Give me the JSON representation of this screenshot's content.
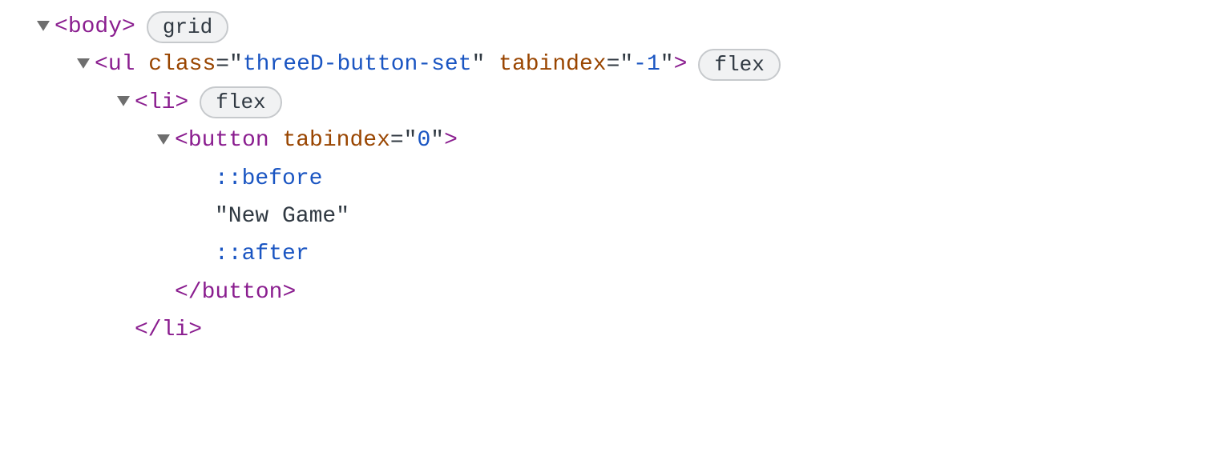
{
  "rows": [
    {
      "indent": 40,
      "twisty": true,
      "parts": [
        {
          "cls": "punct",
          "t": "<"
        },
        {
          "cls": "tag",
          "t": "body"
        },
        {
          "cls": "punct",
          "t": ">"
        }
      ],
      "badge": "grid",
      "name": "dom-node-body",
      "interactable": true
    },
    {
      "indent": 90,
      "twisty": true,
      "parts": [
        {
          "cls": "punct",
          "t": "<"
        },
        {
          "cls": "tag",
          "t": "ul"
        },
        {
          "cls": "text",
          "t": " "
        },
        {
          "cls": "attr",
          "t": "class"
        },
        {
          "cls": "eq",
          "t": "=\""
        },
        {
          "cls": "val",
          "t": "threeD-button-set"
        },
        {
          "cls": "eq",
          "t": "\""
        },
        {
          "cls": "text",
          "t": " "
        },
        {
          "cls": "attr",
          "t": "tabindex"
        },
        {
          "cls": "eq",
          "t": "=\""
        },
        {
          "cls": "val",
          "t": "-1"
        },
        {
          "cls": "eq",
          "t": "\""
        },
        {
          "cls": "punct",
          "t": ">"
        }
      ],
      "badge": "flex",
      "name": "dom-node-ul",
      "interactable": true
    },
    {
      "indent": 140,
      "twisty": true,
      "parts": [
        {
          "cls": "punct",
          "t": "<"
        },
        {
          "cls": "tag",
          "t": "li"
        },
        {
          "cls": "punct",
          "t": ">"
        }
      ],
      "badge": "flex",
      "name": "dom-node-li",
      "interactable": true
    },
    {
      "indent": 190,
      "twisty": true,
      "parts": [
        {
          "cls": "punct",
          "t": "<"
        },
        {
          "cls": "tag",
          "t": "button"
        },
        {
          "cls": "text",
          "t": " "
        },
        {
          "cls": "attr",
          "t": "tabindex"
        },
        {
          "cls": "eq",
          "t": "=\""
        },
        {
          "cls": "val",
          "t": "0"
        },
        {
          "cls": "eq",
          "t": "\""
        },
        {
          "cls": "punct",
          "t": ">"
        }
      ],
      "badge": null,
      "name": "dom-node-button-open",
      "interactable": true
    },
    {
      "indent": 268,
      "twisty": false,
      "parts": [
        {
          "cls": "pseudo",
          "t": "::before"
        }
      ],
      "badge": null,
      "name": "pseudo-before",
      "interactable": true
    },
    {
      "indent": 268,
      "twisty": false,
      "parts": [
        {
          "cls": "text",
          "t": "\"New Game\""
        }
      ],
      "badge": null,
      "name": "text-node-new-game",
      "interactable": true
    },
    {
      "indent": 268,
      "twisty": false,
      "parts": [
        {
          "cls": "pseudo",
          "t": "::after"
        }
      ],
      "badge": null,
      "name": "pseudo-after",
      "interactable": true
    },
    {
      "indent": 218,
      "twisty": false,
      "parts": [
        {
          "cls": "punct",
          "t": "</"
        },
        {
          "cls": "tag",
          "t": "button"
        },
        {
          "cls": "punct",
          "t": ">"
        }
      ],
      "badge": null,
      "name": "dom-node-button-close",
      "interactable": true
    },
    {
      "indent": 168,
      "twisty": false,
      "parts": [
        {
          "cls": "punct",
          "t": "</"
        },
        {
          "cls": "tag",
          "t": "li"
        },
        {
          "cls": "punct",
          "t": ">"
        }
      ],
      "badge": null,
      "name": "dom-node-li-close",
      "interactable": true
    }
  ]
}
